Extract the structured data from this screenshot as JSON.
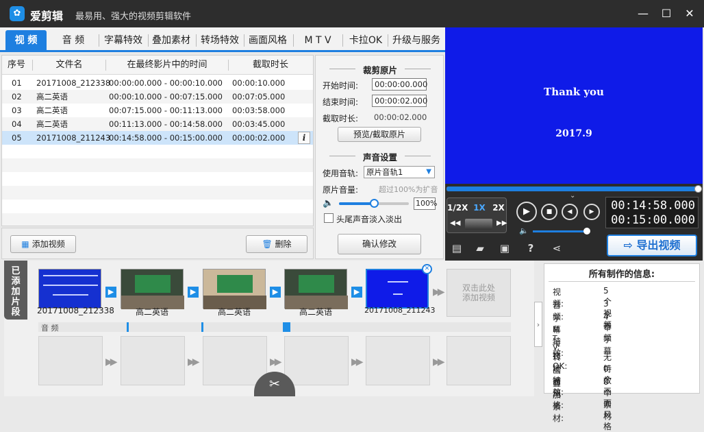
{
  "app": {
    "name": "爱剪辑",
    "slogan": "最易用、强大的视频剪辑软件",
    "logo_icon": "film-reel-icon"
  },
  "window_controls": {
    "minimize": "—",
    "maximize": "☐",
    "close": "✕"
  },
  "tabs": [
    {
      "label": "视  频",
      "active": true
    },
    {
      "label": "音  频"
    },
    {
      "label": "字幕特效"
    },
    {
      "label": "叠加素材"
    },
    {
      "label": "转场特效"
    },
    {
      "label": "画面风格"
    },
    {
      "label": "M T V"
    },
    {
      "label": "卡拉OK"
    },
    {
      "label": "升级与服务"
    }
  ],
  "clip_table": {
    "headers": [
      "序号",
      "文件名",
      "在最终影片中的时间",
      "截取时长"
    ],
    "rows": [
      {
        "idx": "01",
        "name": "20171008_212338",
        "time": "00:00:00.000 - 00:00:10.000",
        "dur": "00:00:10.000"
      },
      {
        "idx": "02",
        "name": "高二英语",
        "time": "00:00:10.000 - 00:07:15.000",
        "dur": "00:07:05.000"
      },
      {
        "idx": "03",
        "name": "高二英语",
        "time": "00:07:15.000 - 00:11:13.000",
        "dur": "00:03:58.000"
      },
      {
        "idx": "04",
        "name": "高二英语",
        "time": "00:11:13.000 - 00:14:58.000",
        "dur": "00:03:45.000"
      },
      {
        "idx": "05",
        "name": "20171008_211243",
        "time": "00:14:58.000 - 00:15:00.000",
        "dur": "00:00:02.000",
        "selected": true
      }
    ],
    "info_icon": "i"
  },
  "list_buttons": {
    "add": "添加视频",
    "delete": "删除"
  },
  "edit": {
    "crop_title": "裁剪原片",
    "start_label": "开始时间:",
    "start_value": "00:00:00.000",
    "end_label": "结束时间:",
    "end_value": "00:00:02.000",
    "dur_label": "截取时长:",
    "dur_value": "00:00:02.000",
    "preview_btn": "预览/截取原片",
    "audio_title": "声音设置",
    "track_label": "使用音轨:",
    "track_value": "原片音轨1",
    "volume_label": "原片音量:",
    "volume_hint": "超过100%为扩音",
    "volume_value": "100%",
    "fade_label": "头尾声音淡入淡出",
    "confirm_btn": "确认修改"
  },
  "preview": {
    "title": "Thank you",
    "date": "2017.9"
  },
  "player": {
    "speeds": [
      "1/2X",
      "1X",
      "2X"
    ],
    "current_time": "00:14:58.000",
    "total_time": "00:15:00.000",
    "export_label": "导出视频"
  },
  "timeline": {
    "side_label": "已添加片段",
    "clips": [
      {
        "caption": "20171008_212338"
      },
      {
        "caption": "高二英语"
      },
      {
        "caption": "高二英语"
      },
      {
        "caption": "高二英语"
      },
      {
        "caption": "20171008_211243"
      }
    ],
    "add_hint": "双击此处\n添加视频",
    "audio_label": "音 频"
  },
  "info_panel": {
    "title": "所有制作的信息:",
    "items": [
      {
        "k": "视    频:",
        "v": "5个视频"
      },
      {
        "k": "音    频:",
        "v": "3个音频"
      },
      {
        "k": "字幕特效:",
        "v": "4个字幕"
      },
      {
        "k": "M  T  V:",
        "v": ""
      },
      {
        "k": "卡 拉 OK:",
        "v": ""
      },
      {
        "k": "转场特效:",
        "v": "无特效"
      },
      {
        "k": "画面风格:",
        "v": "0个画面风格"
      },
      {
        "k": "叠加素材:",
        "v": "0个素材"
      }
    ]
  },
  "colors": {
    "accent": "#1e7fe0",
    "preview_bg": "#0f1be8",
    "dark": "#2b2b2b"
  }
}
